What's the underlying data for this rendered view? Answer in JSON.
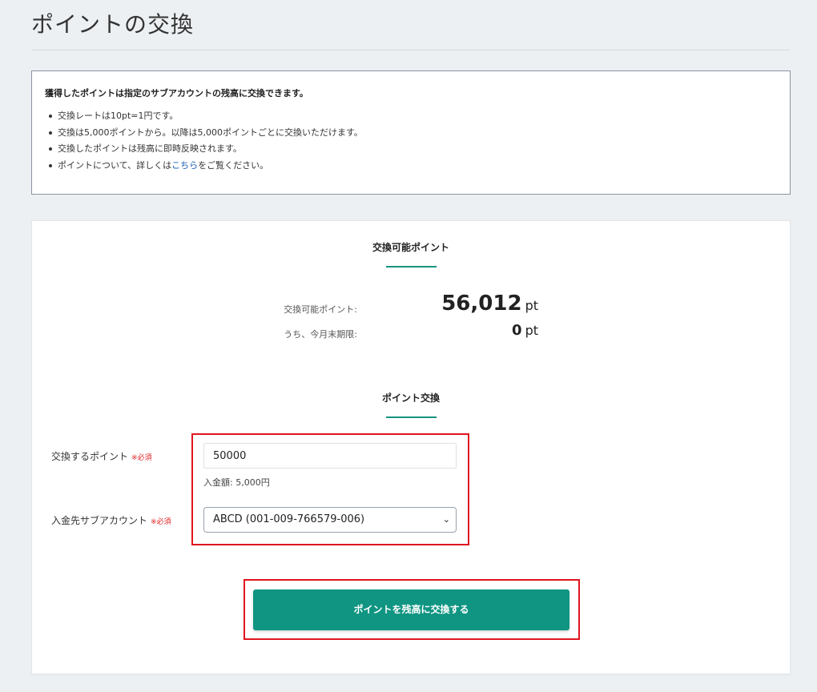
{
  "page": {
    "title": "ポイントの交換"
  },
  "info": {
    "heading": "獲得したポイントは指定のサブアカウントの残高に交換できます。",
    "bullets": [
      "交換レートは10pt=1円です。",
      "交換は5,000ポイントから。以降は5,000ポイントごとに交換いただけます。",
      "交換したポイントは残高に即時反映されます。"
    ],
    "last_bullet_prefix": "ポイントについて、詳しくは",
    "last_bullet_link": "こちら",
    "last_bullet_suffix": "をご覧ください。"
  },
  "available": {
    "section_title": "交換可能ポイント",
    "available_label": "交換可能ポイント:",
    "available_value": "56,012",
    "expiring_label": "うち、今月末期限:",
    "expiring_value": "0",
    "unit": "pt"
  },
  "exchange": {
    "section_title": "ポイント交換",
    "points_label": "交換するポイント",
    "required_mark": "※必須",
    "points_value": "50000",
    "deposit_note": "入金額: 5,000円",
    "account_label": "入金先サブアカウント",
    "account_selected": "ABCD (001-009-766579-006)",
    "submit_label": "ポイントを残高に交換する"
  },
  "colors": {
    "accent": "#0f9582",
    "highlight": "#e0141e",
    "link": "#1a5fb4",
    "required": "#dd2222"
  }
}
